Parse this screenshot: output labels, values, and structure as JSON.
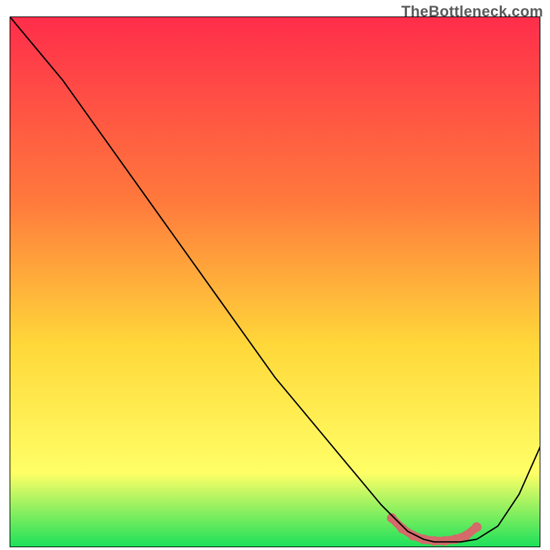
{
  "watermark": {
    "text": "TheBottleneck.com"
  },
  "colors": {
    "gradient_top": "#ff2d4b",
    "gradient_mid1": "#ff7a3c",
    "gradient_mid2": "#ffd83a",
    "gradient_mid3": "#ffff66",
    "gradient_bottom": "#1be05a",
    "curve": "#000000",
    "marker": "#d46a6a",
    "frame": "#000000"
  },
  "chart_data": {
    "type": "line",
    "title": "",
    "xlabel": "",
    "ylabel": "",
    "xlim": [
      0,
      100
    ],
    "ylim": [
      0,
      100
    ],
    "grid": false,
    "legend": false,
    "series": [
      {
        "name": "bottleneck-curve",
        "x": [
          0,
          5,
          10,
          15,
          20,
          25,
          30,
          35,
          40,
          45,
          50,
          55,
          60,
          65,
          70,
          75,
          78,
          80,
          82,
          85,
          88,
          92,
          96,
          100
        ],
        "values": [
          100,
          94,
          88,
          81,
          74,
          67,
          60,
          53,
          46,
          39,
          32,
          26,
          20,
          14,
          8,
          3,
          1.5,
          1,
          1,
          1,
          1.5,
          4,
          10,
          19
        ]
      }
    ],
    "markers": {
      "name": "highlight-range",
      "x": [
        72,
        74,
        76,
        78,
        80,
        82,
        84,
        86,
        88
      ],
      "values": [
        5.5,
        3.5,
        2.2,
        1.5,
        1.2,
        1.2,
        1.5,
        2.2,
        3.8
      ]
    },
    "annotations": []
  }
}
